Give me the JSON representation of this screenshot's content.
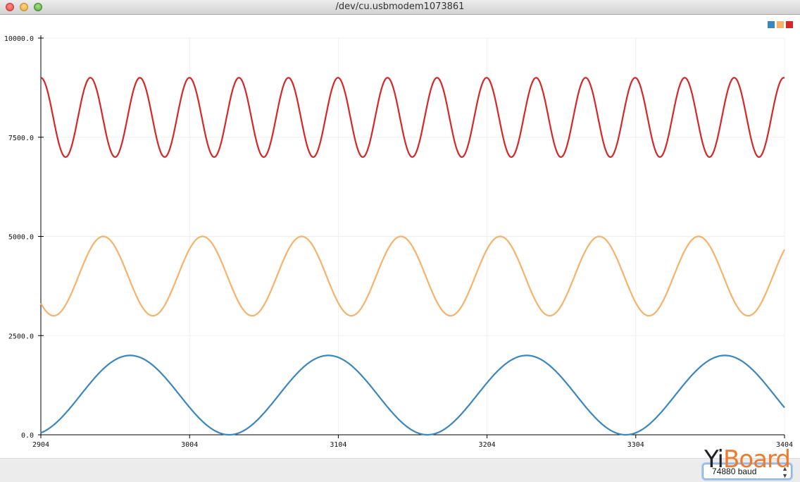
{
  "window": {
    "title": "/dev/cu.usbmodem1073861"
  },
  "chart_data": {
    "type": "line",
    "xlim": [
      2904,
      3404
    ],
    "ylim": [
      0,
      10000
    ],
    "x_ticks": [
      "2904",
      "3004",
      "3104",
      "3204",
      "3304",
      "3404"
    ],
    "y_ticks": [
      "0.0",
      "2500.0",
      "5000.0",
      "7500.0",
      "10000.0"
    ],
    "grid": true,
    "legend_placement": "top-right",
    "series": [
      {
        "color": "#3a87c0",
        "center": 1000,
        "amplitude": 1000,
        "period": 133.3,
        "value_at_xmin": 0,
        "x_of_first_peak": 2964,
        "trend": "rising"
      },
      {
        "color": "#f7b26a",
        "center": 4000,
        "amplitude": 1000,
        "period": 66.7,
        "value_at_xmin": 3380,
        "x_of_first_peak": 2946,
        "trend": "falling"
      },
      {
        "color": "#d62728",
        "center": 8000,
        "amplitude": 1000,
        "period": 33.3,
        "value_at_xmin": 9000,
        "x_of_first_peak": 2904,
        "trend": "falling"
      }
    ]
  },
  "bottom_bar": {
    "baud_value": "74880 baud"
  },
  "watermark": {
    "part1": "Yi",
    "part2": "Board"
  }
}
